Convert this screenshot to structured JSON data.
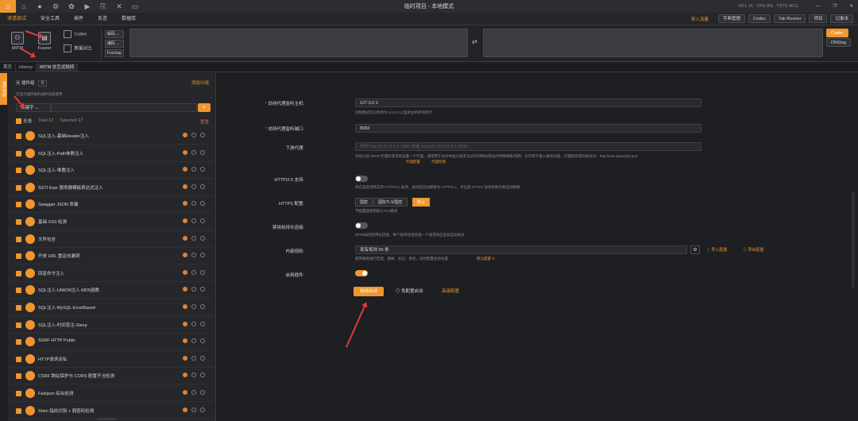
{
  "window": {
    "title": "临时项目 - 本地模式",
    "stats": [
      "NTL 91",
      "CPU 8%",
      "YSTS 9011"
    ]
  },
  "menus": [
    "渗透测试",
    "安全工具",
    "插件",
    "反连",
    "数据库"
  ],
  "menu_right": {
    "import_link": "导入流量",
    "buttons": [
      "字典管理",
      "Codec",
      "Yak Runner",
      "项目",
      "记事本"
    ]
  },
  "tools": [
    {
      "label": "MITM",
      "icon": "mitm-icon"
    },
    {
      "label": "Fuzzer",
      "icon": "fuzzer-icon"
    },
    {
      "label": "Codec",
      "icon": "codec-icon"
    },
    {
      "label": "数据对比",
      "icon": "compare-icon"
    }
  ],
  "codec": {
    "dropdowns": [
      "解码",
      "编码",
      "Fuzztag"
    ],
    "side_buttons": [
      "Codec",
      "DNSlog"
    ]
  },
  "tabs": [
    "首页",
    "History",
    "MITM 交互式劫持"
  ],
  "vertical_tab": "插件列表",
  "plugin_panel": {
    "title": "插件组",
    "count": "0",
    "add_link": "添加分组",
    "hint": "仅显示插件组的插件同组使用",
    "search_type": "关键字",
    "filter_all": "全选",
    "filter_total_label": "Total",
    "filter_total": "17",
    "filter_selected_label": "Selected",
    "filter_selected": "17",
    "clear_link": "重置",
    "plugins": [
      "SQL注入-基础Header注入",
      "SQL注入-Path参数注入",
      "SQL注入-堆叠注入",
      "SSTI Expr 服务器模板表达式注入",
      "Swagger JSON 泄漏",
      "基础 XSS 检测",
      "文件包含",
      "开放 URL 重定向漏洞",
      "回显命令注入",
      "SQL注入-UNION注入-MD5函数",
      "SQL注入-MySQL-ErrorBased",
      "SQL注入-时间盲注-Sleep",
      "SSRF HTTP Public",
      "HTTP请求走私",
      "CSRF 跨站保护与 CORS 配置不当检测",
      "Fastjson 综合检测",
      "Shiro 指纹识别 + 弱密码检测"
    ]
  },
  "form": {
    "host_label": "劫持代理监听主机:",
    "host_value": "127.0.0.1",
    "host_help": "远程模式可以修改为 0.0.0.0 以监听主机所有网卡",
    "port_label": "劫持代理监听端口:",
    "port_value": "8083",
    "downstream_label": "下游代理:",
    "downstream_placeholder": "例如 http://127.0.0.1:7890 或者 socks5://127.0.0.1:7890",
    "downstream_help": "为经过该 MITM 代理的请求再设置一个代理，通常用于访问中国大陆无法访问的网站或访问特殊网络/内网，也可用于接入被动扫描，代理如有密码格式为：http://user:pass@ip:port",
    "proxy_link1": "代理配置",
    "proxy_link2": "代理检测",
    "http2_label": "HTTP/2.0 支持:",
    "http2_help": "开启该选项将支持 HTTP/2.0 劫持，关闭后自动降级为 HTTP/1.1，开启后 HTTP2 协商失败也会自动降级",
    "https_label": "HTTPS 配置:",
    "https_options": [
      "国密",
      "国际TLS/国密",
      "默认"
    ],
    "https_help": "不配置国密则默认TLS模式",
    "keepalive_label": "禁用劫持长连接:",
    "keepalive_help": "MITM劫持禁用长连接，每个劫持连接处理一个请求响应后会自动关闭",
    "rules_label": "内容规则:",
    "rules_value": "现有规则 55 条",
    "rules_import": "导入配置",
    "rules_export": "导出配置",
    "rules_help": "使用规则进行匹配、替换、标记、染色，同时配置生效位置",
    "rules_reset": "默认配置",
    "plugin_label": "启用插件:",
    "start_button": "劫持启动",
    "no_config_button": "免配置启动",
    "advanced_link": "高级配置"
  }
}
